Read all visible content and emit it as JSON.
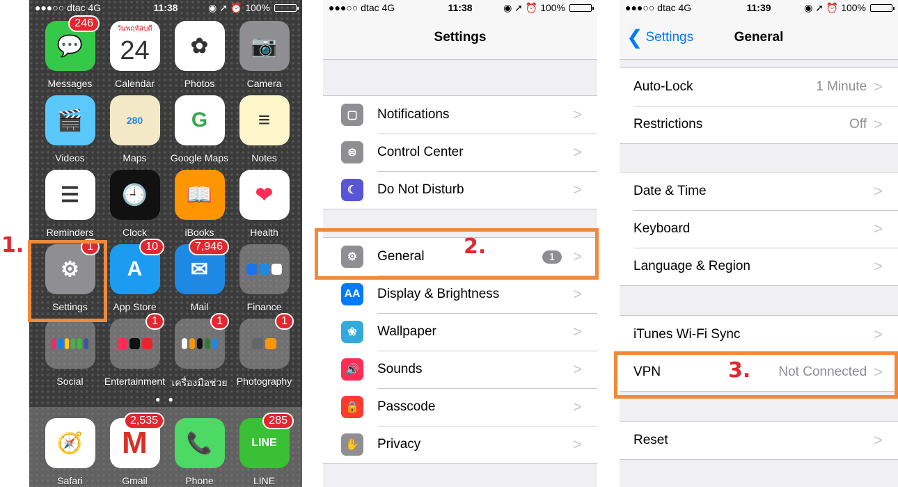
{
  "panel1": {
    "status": {
      "carrier": "●●●○○ dtac  4G",
      "time": "11:38",
      "right": "◉ ➚ ⏰ 100%",
      "battery_level": 1.0
    },
    "apps": [
      {
        "name": "messages",
        "label": "Messages",
        "badge": "246",
        "color": "#35c94a",
        "glyph": "💬"
      },
      {
        "name": "calendar",
        "label": "Calendar",
        "badge": "",
        "color": "#ffffff",
        "glyph": "24",
        "header": "วันพฤหัสบดี"
      },
      {
        "name": "photos",
        "label": "Photos",
        "badge": "",
        "color": "#ffffff",
        "glyph": "✿"
      },
      {
        "name": "camera",
        "label": "Camera",
        "badge": "",
        "color": "#8e8e93",
        "glyph": "📷"
      },
      {
        "name": "videos",
        "label": "Videos",
        "badge": "",
        "color": "#5ac8fa",
        "glyph": "🎬"
      },
      {
        "name": "maps",
        "label": "Maps",
        "badge": "",
        "color": "#f4e9c6",
        "glyph": "280"
      },
      {
        "name": "google-maps",
        "label": "Google Maps",
        "badge": "",
        "color": "#ffffff",
        "glyph": "G"
      },
      {
        "name": "notes",
        "label": "Notes",
        "badge": "",
        "color": "#fff6cc",
        "glyph": "≡"
      },
      {
        "name": "reminders",
        "label": "Reminders",
        "badge": "",
        "color": "#ffffff",
        "glyph": "☰"
      },
      {
        "name": "clock",
        "label": "Clock",
        "badge": "",
        "color": "#111111",
        "glyph": "🕘"
      },
      {
        "name": "ibooks",
        "label": "iBooks",
        "badge": "",
        "color": "#ff9500",
        "glyph": "📖"
      },
      {
        "name": "health",
        "label": "Health",
        "badge": "",
        "color": "#ffffff",
        "glyph": "❤"
      },
      {
        "name": "settings",
        "label": "Settings",
        "badge": "1",
        "color": "#8e8e93",
        "glyph": "⚙"
      },
      {
        "name": "app-store",
        "label": "App Store",
        "badge": "10",
        "color": "#1d9bf0",
        "glyph": "A"
      },
      {
        "name": "mail",
        "label": "Mail",
        "badge": "7,946",
        "color": "#1e88e5",
        "glyph": "✉"
      },
      {
        "name": "finance",
        "label": "Finance",
        "badge": "",
        "color": "folder",
        "glyph": ""
      },
      {
        "name": "social",
        "label": "Social",
        "badge": "",
        "color": "folder",
        "glyph": ""
      },
      {
        "name": "entertainment",
        "label": "Entertainment",
        "badge": "1",
        "color": "folder",
        "glyph": ""
      },
      {
        "name": "tools-folder",
        "label": "เครื่องมือช่วย",
        "badge": "1",
        "color": "folder",
        "glyph": ""
      },
      {
        "name": "photography",
        "label": "Photography",
        "badge": "1",
        "color": "folder",
        "glyph": ""
      }
    ],
    "page_dots": "● ●",
    "dock": [
      {
        "name": "safari",
        "label": "Safari",
        "badge": "",
        "color": "#ffffff",
        "glyph": "🧭"
      },
      {
        "name": "gmail",
        "label": "Gmail",
        "badge": "2,535",
        "color": "#ffffff",
        "glyph": "M"
      },
      {
        "name": "phone",
        "label": "Phone",
        "badge": "",
        "color": "#4cd964",
        "glyph": "📞"
      },
      {
        "name": "line",
        "label": "LINE",
        "badge": "285",
        "color": "#3ac034",
        "glyph": "LINE"
      }
    ],
    "step_label": "1."
  },
  "panel2": {
    "status": {
      "carrier": "●●●○○ dtac  4G",
      "time": "11:38",
      "right": "◉ ➚ ⏰ 100%",
      "battery_level": 1.0
    },
    "title": "Settings",
    "group1": [
      {
        "name": "notifications",
        "label": "Notifications",
        "icon_color": "#8e8e93",
        "glyph": "▢"
      },
      {
        "name": "control-center",
        "label": "Control Center",
        "icon_color": "#8e8e93",
        "glyph": "⊜"
      },
      {
        "name": "do-not-disturb",
        "label": "Do Not Disturb",
        "icon_color": "#5856d6",
        "glyph": "☾"
      }
    ],
    "group2": [
      {
        "name": "general",
        "label": "General",
        "icon_color": "#8e8e93",
        "glyph": "⚙",
        "pill": "1"
      },
      {
        "name": "display-brightness",
        "label": "Display & Brightness",
        "icon_color": "#007aff",
        "glyph": "AA"
      },
      {
        "name": "wallpaper",
        "label": "Wallpaper",
        "icon_color": "#34aadc",
        "glyph": "❀"
      },
      {
        "name": "sounds",
        "label": "Sounds",
        "icon_color": "#ff2d55",
        "glyph": "🔊"
      },
      {
        "name": "passcode",
        "label": "Passcode",
        "icon_color": "#ff3b30",
        "glyph": "🔒"
      },
      {
        "name": "privacy",
        "label": "Privacy",
        "icon_color": "#8e8e93",
        "glyph": "✋"
      }
    ],
    "chevron": ">",
    "step_label": "2."
  },
  "panel3": {
    "status": {
      "carrier": "●●●○○ dtac  4G",
      "time": "11:39",
      "right": "◉ ➚ ⏰ 100%",
      "battery_level": 1.0
    },
    "back_label": "Settings",
    "back_chevron": "❮",
    "title": "General",
    "group1": [
      {
        "name": "auto-lock",
        "label": "Auto-Lock",
        "value": "1 Minute"
      },
      {
        "name": "restrictions",
        "label": "Restrictions",
        "value": "Off"
      }
    ],
    "group2": [
      {
        "name": "date-time",
        "label": "Date & Time",
        "value": ""
      },
      {
        "name": "keyboard",
        "label": "Keyboard",
        "value": ""
      },
      {
        "name": "language-region",
        "label": "Language & Region",
        "value": ""
      }
    ],
    "group3": [
      {
        "name": "itunes-wifi-sync",
        "label": "iTunes Wi-Fi Sync",
        "value": ""
      },
      {
        "name": "vpn",
        "label": "VPN",
        "value": "Not Connected"
      }
    ],
    "group4": [
      {
        "name": "reset",
        "label": "Reset",
        "value": ""
      }
    ],
    "chevron": ">",
    "step_label": "3."
  },
  "colors": {
    "annotation_box": "#f08a3a",
    "step_label": "#e2272f",
    "link_blue": "#007aff"
  }
}
